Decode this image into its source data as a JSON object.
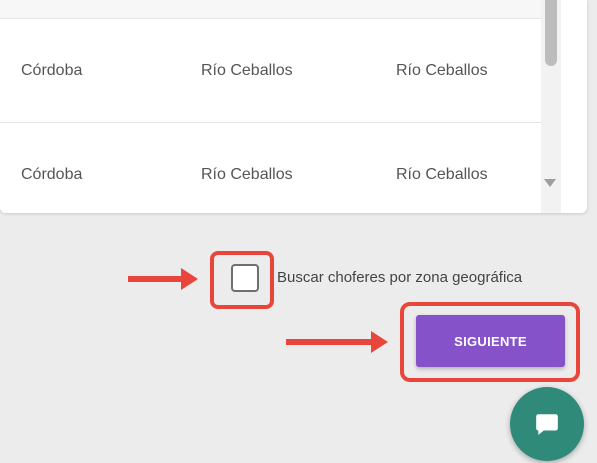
{
  "table": {
    "rows": [
      {
        "col1": "Córdoba",
        "col2": "Río Ceballos",
        "col3": "Río Ceballos"
      },
      {
        "col1": "Córdoba",
        "col2": "Río Ceballos",
        "col3": "Río Ceballos"
      }
    ]
  },
  "filter": {
    "checkbox_label": "Buscar choferes por zona geográfica",
    "checked": false
  },
  "actions": {
    "next_label": "SIGUIENTE"
  },
  "icons": {
    "scroll_down": "triangle-down-icon",
    "chat": "chat-bubble-icon",
    "annotation": "red-arrow-icon"
  },
  "colors": {
    "primary": "#8552c9",
    "chat_fab": "#2f8a7a",
    "annotation": "#e8463a"
  }
}
